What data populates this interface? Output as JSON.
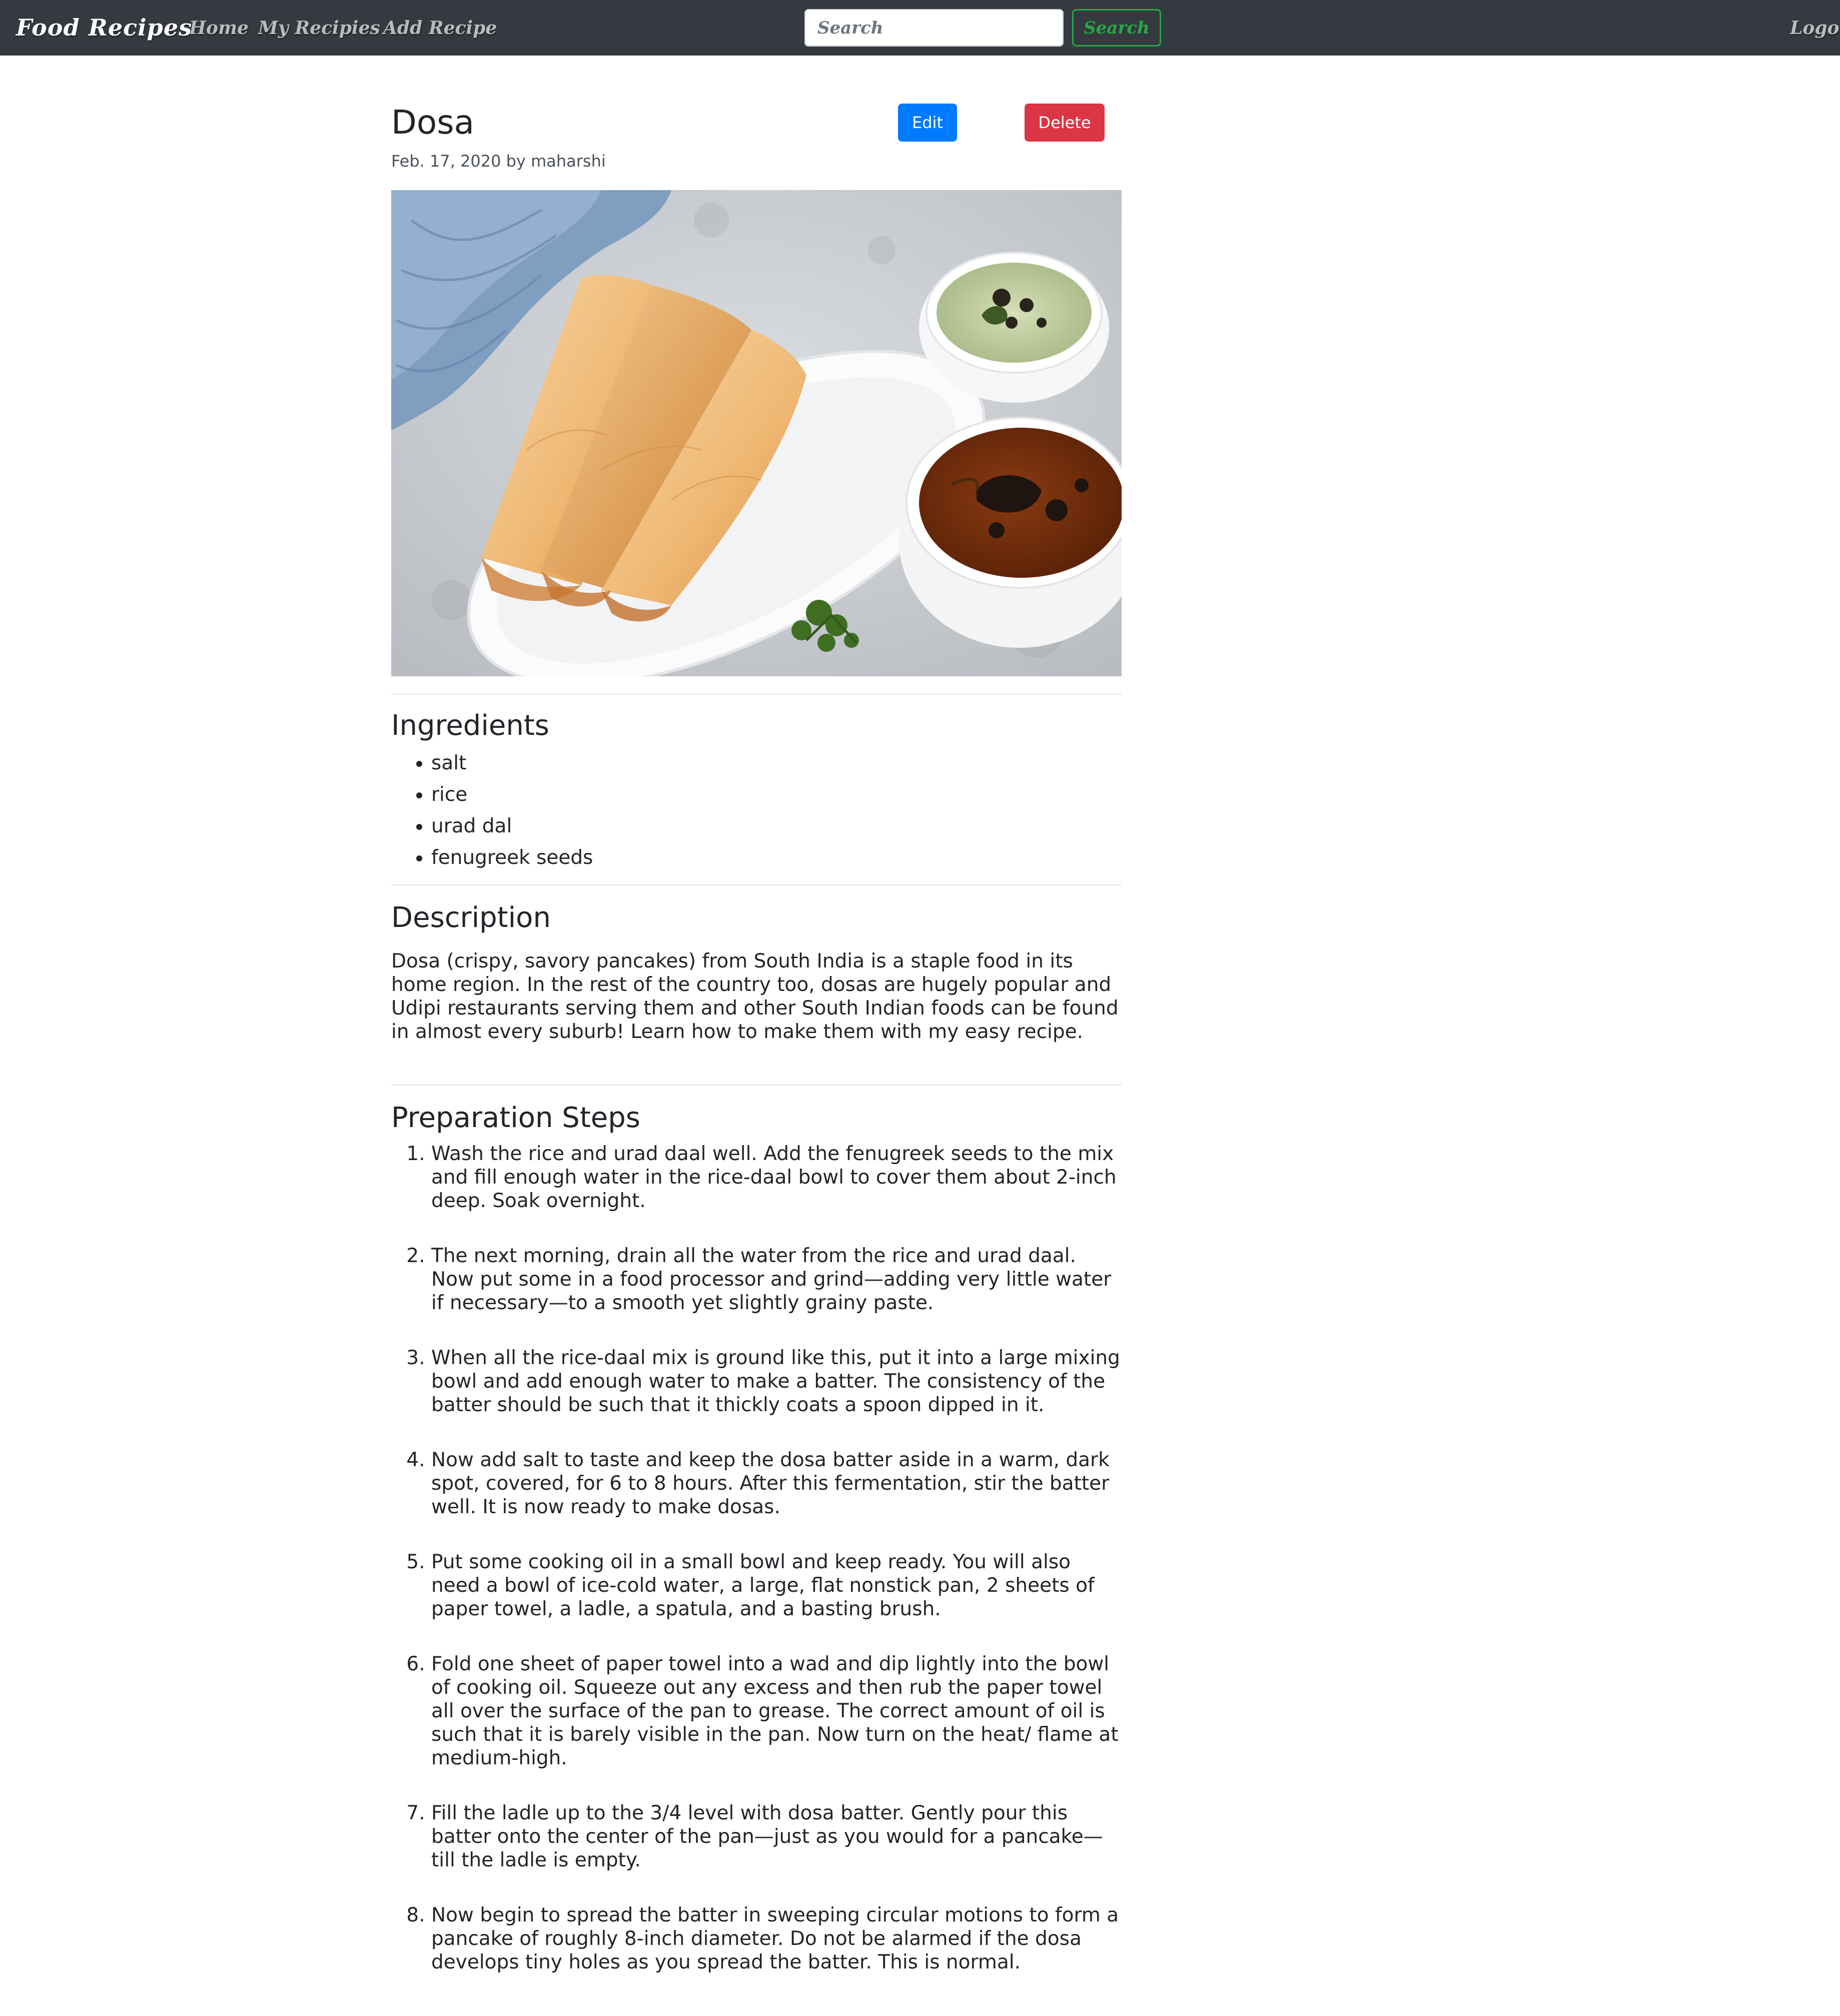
{
  "navbar": {
    "brand": "Food Recipes",
    "links": [
      "Home",
      "My Recipies",
      "Add Recipe"
    ],
    "search_placeholder": "Search",
    "search_button": "Search",
    "logout": "Logout"
  },
  "recipe": {
    "title": "Dosa",
    "meta": "Feb. 17, 2020 by maharshi",
    "edit_label": "Edit",
    "delete_label": "Delete",
    "ingredients_heading": "Ingredients",
    "ingredients": [
      "salt",
      "rice",
      "urad dal",
      "fenugreek seeds"
    ],
    "description_heading": "Description",
    "description": "Dosa (crispy, savory pancakes) from South India is a staple food in its home region. In the rest of the country too, dosas are hugely popular and Udipi restaurants serving them and other South Indian foods can be found in almost every suburb! Learn how to make them with my easy recipe.",
    "steps_heading": "Preparation Steps",
    "steps": [
      "Wash the rice and urad daal well. Add the fenugreek seeds to the mix and fill enough water in the rice-daal bowl to cover them about 2-inch deep. Soak overnight.",
      "The next morning, drain all the water from the rice and urad daal. Now put some in a food processor and grind—adding very little water if necessary—to a smooth yet slightly grainy paste.",
      "When all the rice-daal mix is ground like this, put it into a large mixing bowl and add enough water to make a batter. The consistency of the batter should be such that it thickly coats a spoon dipped in it.",
      "Now add salt to taste and keep the dosa batter aside in a warm, dark spot, covered, for 6 to 8 hours. After this fermentation, stir the batter well. It is now ready to make dosas.",
      "Put some cooking oil in a small bowl and keep ready. You will also need a bowl of ice-cold water, a large, flat nonstick pan, 2 sheets of paper towel, a ladle, a spatula, and a basting brush.",
      "Fold one sheet of paper towel into a wad and dip lightly into the bowl of cooking oil. Squeeze out any excess and then rub the paper towel all over the surface of the pan to grease. The correct amount of oil is such that it is barely visible in the pan. Now turn on the heat/ flame at medium-high.",
      "Fill the ladle up to the 3/4 level with dosa batter. Gently pour this batter onto the center of the pan—just as you would for a pancake—till the ladle is empty.",
      "Now begin to spread the batter in sweeping circular motions to form a pancake of roughly 8-inch diameter. Do not be alarmed if the dosa develops tiny holes as you spread the batter. This is normal."
    ]
  }
}
